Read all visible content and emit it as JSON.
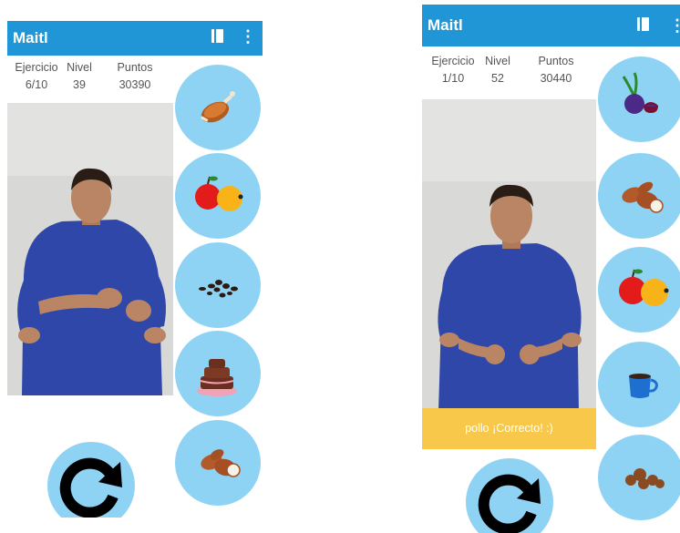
{
  "app": {
    "title": "Maitl"
  },
  "screens": [
    {
      "stats": {
        "exercise_label": "Ejercicio",
        "exercise_value": "6/10",
        "level_label": "Nivel",
        "level_value": "39",
        "points_label": "Puntos",
        "points_value": "30390"
      },
      "choices": [
        "roast-chicken-icon",
        "apple-orange-icon",
        "coffee-beans-icon",
        "chocolate-cake-icon",
        "sweet-potatoes-icon"
      ],
      "replay_icon": "replay-icon"
    },
    {
      "stats": {
        "exercise_label": "Ejercicio",
        "exercise_value": "1/10",
        "level_label": "Nivel",
        "level_value": "52",
        "points_label": "Puntos",
        "points_value": "30440"
      },
      "feedback": "pollo ¡Correcto! :)",
      "choices": [
        "beet-icon",
        "sweet-potatoes-icon",
        "apple-orange-icon",
        "coffee-cup-icon",
        "nuts-icon"
      ],
      "replay_icon": "replay-icon"
    }
  ],
  "colors": {
    "appbar": "#2196d6",
    "choice_bg": "#8fd3f4",
    "feedback_bg": "#f7c84a"
  }
}
